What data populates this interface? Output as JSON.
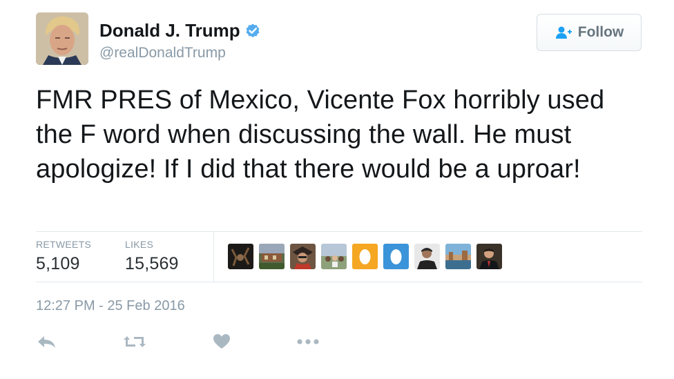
{
  "author": {
    "name": "Donald J. Trump",
    "handle": "@realDonaldTrump",
    "verified": true,
    "avatar_icon": "profile-photo",
    "verified_icon": "verified-badge-icon"
  },
  "follow_button": {
    "label": "Follow",
    "icon": "add-user-icon"
  },
  "tweet": {
    "text": "FMR PRES of Mexico, Vicente Fox horribly used the F word when discussing the wall. He must apologize! If I did that there would be a uproar!"
  },
  "stats": {
    "retweets_label": "RETWEETS",
    "retweets_value": "5,109",
    "likes_label": "LIKES",
    "likes_value": "15,569"
  },
  "likers": [
    {
      "icon": "liker-avatar-1"
    },
    {
      "icon": "liker-avatar-2"
    },
    {
      "icon": "liker-avatar-3"
    },
    {
      "icon": "liker-avatar-4"
    },
    {
      "icon": "liker-avatar-default-orange"
    },
    {
      "icon": "liker-avatar-default-blue"
    },
    {
      "icon": "liker-avatar-7"
    },
    {
      "icon": "liker-avatar-8"
    },
    {
      "icon": "liker-avatar-9"
    }
  ],
  "timestamp": "12:27 PM - 25 Feb 2016",
  "actions": {
    "reply_icon": "reply-icon",
    "retweet_icon": "retweet-icon",
    "like_icon": "heart-icon",
    "more_icon": "more-icon"
  },
  "colors": {
    "text": "#14171a",
    "secondary": "#8899a6",
    "verified": "#1da1f2",
    "divider": "#e1e8ed",
    "action_icon": "#aab8c2"
  }
}
